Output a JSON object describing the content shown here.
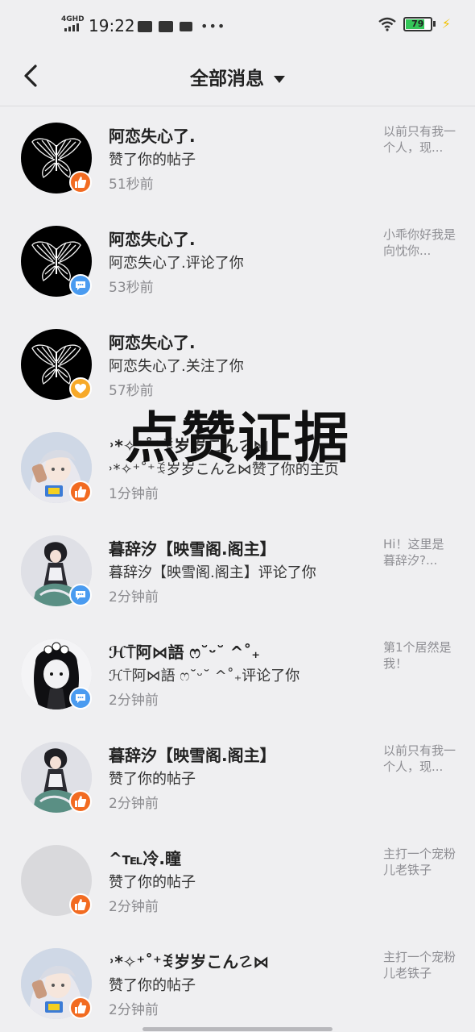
{
  "status_bar": {
    "network": "4GHD",
    "time": "19:22",
    "battery": "79",
    "battery_level": 0.79
  },
  "header": {
    "title": "全部消息"
  },
  "overlay_text": "点赞证据",
  "messages": [
    {
      "name": "阿恋失心了.",
      "action": "赞了你的帖子",
      "time": "51秒前",
      "preview": "以前只有我一个人，现...",
      "badge": "like",
      "avatar": "butterfly"
    },
    {
      "name": "阿恋失心了.",
      "action": "阿恋失心了.评论了你",
      "time": "53秒前",
      "preview": "小乖你好我是向忱你...",
      "badge": "comment",
      "avatar": "butterfly"
    },
    {
      "name": "阿恋失心了.",
      "action": "阿恋失心了.关注了你",
      "time": "57秒前",
      "preview": "",
      "badge": "follow",
      "avatar": "butterfly"
    },
    {
      "name": "˒*✧⁺˚⁺ꉂ岁岁こん☡⋈",
      "action": "˒*✧⁺˚⁺ꉂ岁岁こん☡⋈赞了你的主页",
      "time": "1分钟前",
      "preview": "",
      "badge": "like",
      "avatar": "anime-silver"
    },
    {
      "name": "暮辞汐【映雪阁.阁主】",
      "action": "暮辞汐【映雪阁.阁主】评论了你",
      "time": "2分钟前",
      "preview": "Hi！这里是暮辞汐?...",
      "badge": "comment",
      "avatar": "anime-dark"
    },
    {
      "name": "ℋ⍑阿⋈語 ෆ˘ᵕ˘ ^˚₊",
      "action": "ℋ⍑阿⋈語 ෆ˘ᵕ˘ ^˚₊评论了你",
      "time": "2分钟前",
      "preview": "第1个居然是我！",
      "badge": "comment",
      "avatar": "anime-bw"
    },
    {
      "name": "暮辞汐【映雪阁.阁主】",
      "action": "赞了你的帖子",
      "time": "2分钟前",
      "preview": "以前只有我一个人，现...",
      "badge": "like",
      "avatar": "anime-dark"
    },
    {
      "name": "^℡冷.瞳",
      "action": "赞了你的帖子",
      "time": "2分钟前",
      "preview": "主打一个宠粉儿老铁子",
      "badge": "like",
      "avatar": "blank"
    },
    {
      "name": "˒*✧⁺˚⁺ꉂ岁岁こん☡⋈",
      "action": "赞了你的帖子",
      "time": "2分钟前",
      "preview": "主打一个宠粉儿老铁子",
      "badge": "like",
      "avatar": "anime-silver"
    }
  ]
}
